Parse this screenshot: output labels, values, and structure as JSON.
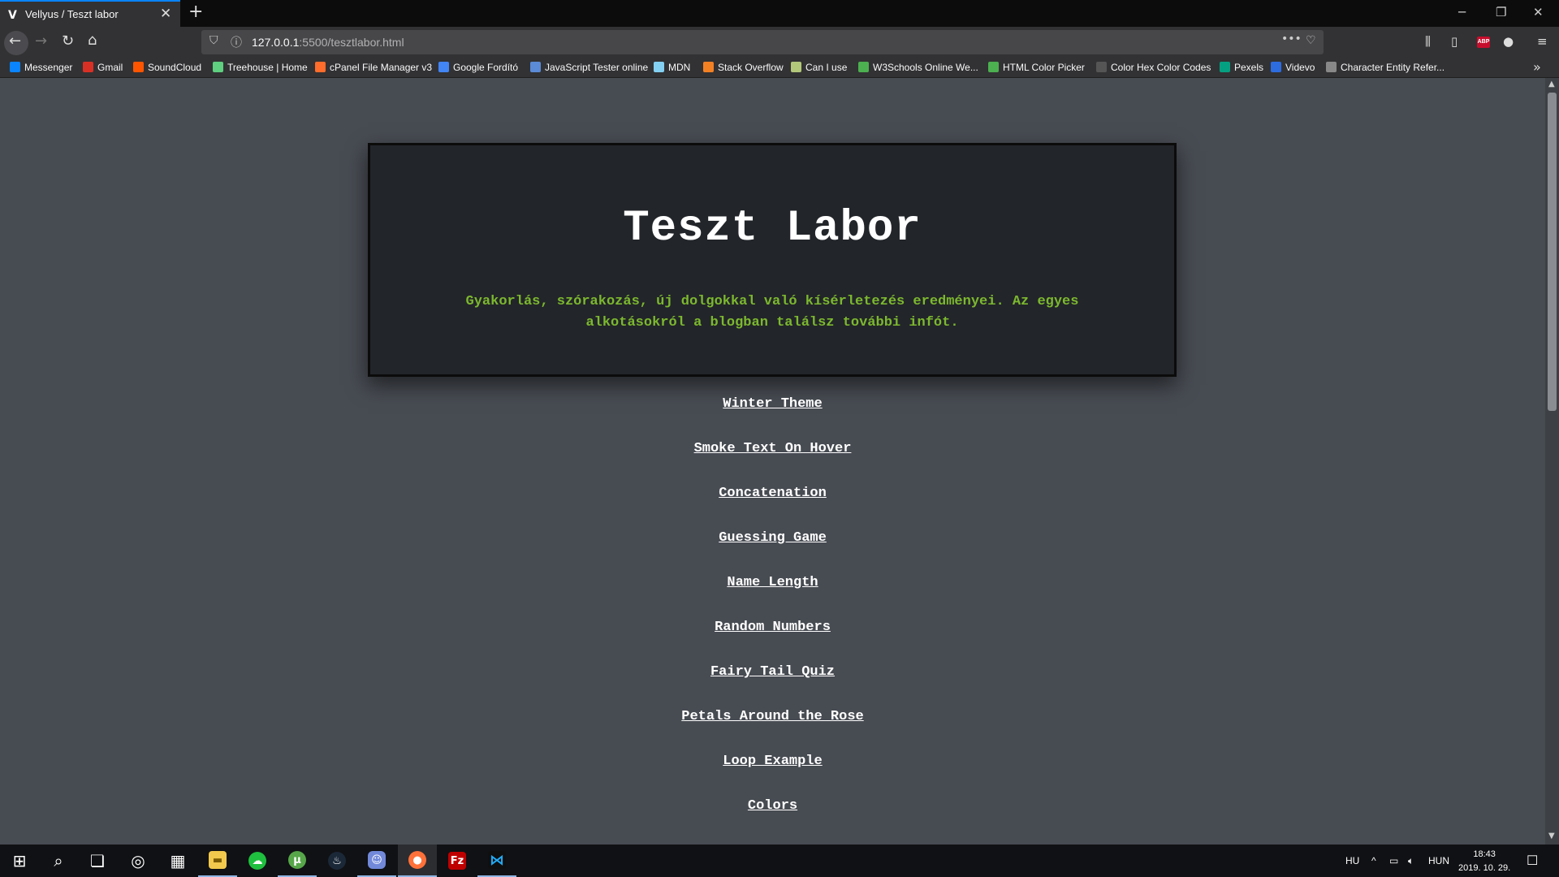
{
  "browser": {
    "tab_title": "Vellyus / Teszt labor",
    "tab_favicon": "V",
    "url_host": "127.0.0.1",
    "url_rest": ":5500/tesztlabor.html",
    "bookmarks": [
      {
        "label": "Messenger",
        "color": "#0a84ff"
      },
      {
        "label": "Gmail",
        "color": "#d93025"
      },
      {
        "label": "SoundCloud",
        "color": "#ff5500"
      },
      {
        "label": "Treehouse | Home",
        "color": "#5fcf80"
      },
      {
        "label": "cPanel File Manager v3",
        "color": "#ff6c2c"
      },
      {
        "label": "Google Fordító",
        "color": "#4285f4"
      },
      {
        "label": "JavaScript Tester online",
        "color": "#5b8bd6"
      },
      {
        "label": "MDN",
        "color": "#83d0f2"
      },
      {
        "label": "Stack Overflow",
        "color": "#f48024"
      },
      {
        "label": "Can I use",
        "color": "#b3c77b"
      },
      {
        "label": "W3Schools Online We...",
        "color": "#4caf50"
      },
      {
        "label": "HTML Color Picker",
        "color": "#4caf50"
      },
      {
        "label": "Color Hex Color Codes",
        "color": "#555555"
      },
      {
        "label": "Pexels",
        "color": "#05a081"
      },
      {
        "label": "Videvo",
        "color": "#2d6cdf"
      },
      {
        "label": "Character Entity Refer...",
        "color": "#888888"
      }
    ]
  },
  "page": {
    "title": "Teszt Labor",
    "subtitle": "Gyakorlás, szórakozás, új dolgokkal való kísérletezés eredményei. Az egyes alkotásokról a blogban találsz további infót.",
    "links": [
      "Winter Theme",
      "Smoke Text On Hover",
      "Concatenation",
      "Guessing Game",
      "Name Length",
      "Random Numbers",
      "Fairy Tail Quiz",
      "Petals Around the Rose",
      "Loop Example",
      "Colors"
    ],
    "accent_color": "#7cb82f",
    "background_color": "#474b52",
    "card_color": "#222529"
  },
  "taskbar": {
    "lang_short": "HU",
    "lang_full": "HUN",
    "time": "18:43",
    "date": "2019. 10. 29."
  }
}
